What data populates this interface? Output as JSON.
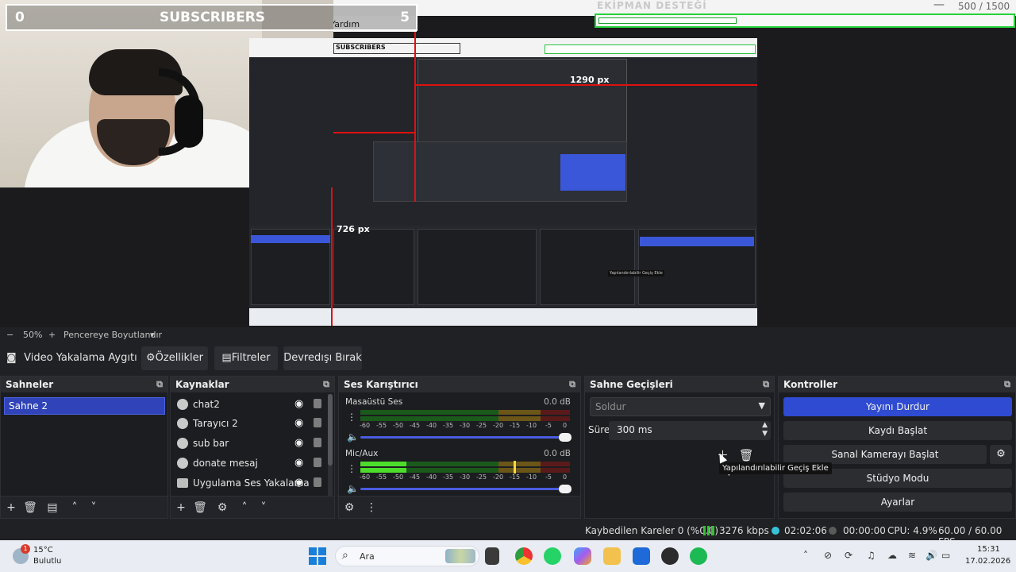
{
  "overlay": {
    "subscriber_count_left": "0",
    "subscriber_label": "SUBSCRIBERS",
    "subscriber_count_right": "5",
    "menu_hint": "Yardım",
    "equipment_title": "EKİPMAN DESTEĞİ",
    "equipment_count": "500 / 1500",
    "equipment_progress": 0.33,
    "dimension_width": "1290 px",
    "dimension_height": "726 px",
    "nested_tooltip": "Yapılandırılabilir Geçiş Ekle",
    "nested_subscribers": "SUBSCRIBERS"
  },
  "zoom_bar": {
    "minus": "−",
    "zoom": "50%",
    "plus": "+",
    "fit_label": "Pencereye Boyutlandır",
    "dropdown": "▾"
  },
  "source_toolbar": {
    "device_name": "Video Yakalama Aygıtı",
    "properties": "Özellikler",
    "filters": "Filtreler",
    "deactivate": "Devredışı Bırak"
  },
  "scenes": {
    "title": "Sahneler",
    "items": [
      "Sahne 2"
    ]
  },
  "sources": {
    "title": "Kaynaklar",
    "items": [
      {
        "label": "chat2",
        "icon": "globe-icon"
      },
      {
        "label": "Tarayıcı 2",
        "icon": "globe-icon"
      },
      {
        "label": "sub bar",
        "icon": "globe-icon"
      },
      {
        "label": "donate mesaj",
        "icon": "globe-icon"
      },
      {
        "label": "Uygulama Ses Yakalama",
        "icon": "speaker-icon"
      }
    ]
  },
  "mixer": {
    "title": "Ses Karıştırıcı",
    "scale": [
      "-60",
      "-55",
      "-50",
      "-45",
      "-40",
      "-35",
      "-30",
      "-25",
      "-20",
      "-15",
      "-10",
      "-5",
      "0"
    ],
    "channels": [
      {
        "name": "Masaüstü Ses",
        "db": "0.0 dB",
        "level": 0.0,
        "peak": null,
        "volume": 1.0
      },
      {
        "name": "Mic/Aux",
        "db": "0.0 dB",
        "level": 0.22,
        "peak": 0.73,
        "volume": 1.0
      }
    ]
  },
  "transitions": {
    "title": "Sahne Geçişleri",
    "selected": "Soldur",
    "duration_label": "Süre",
    "duration_value": "300 ms",
    "tooltip": "Yapılandırılabilir Geçiş Ekle"
  },
  "controls": {
    "title": "Kontroller",
    "stop_stream": "Yayını Durdur",
    "start_recording": "Kaydı Başlat",
    "start_virtual_cam": "Sanal Kamerayı Başlat",
    "studio_mode": "Stüdyo Modu",
    "settings": "Ayarlar"
  },
  "status": {
    "dropped_frames": "Kaybedilen Kareler 0 (%0.0)",
    "bitrate": "3276 kbps",
    "stream_time": "02:02:06",
    "record_time": "00:00:00",
    "cpu": "CPU: 4.9%",
    "fps": "60.00 / 60.00 FPS"
  },
  "taskbar": {
    "weather_temp": "15°C",
    "weather_condition": "Bulutlu",
    "weather_badge": "1",
    "search_placeholder": "Ara",
    "time": "15:31",
    "date": "17.02.2026"
  },
  "colors": {
    "accent": "#2f4bd2",
    "panel_bg": "#1c1d20",
    "meter_green": "#4cdd2c",
    "meter_yellow": "#6b5618",
    "meter_red": "#5a1a1a",
    "progress_green": "#27d23a"
  }
}
